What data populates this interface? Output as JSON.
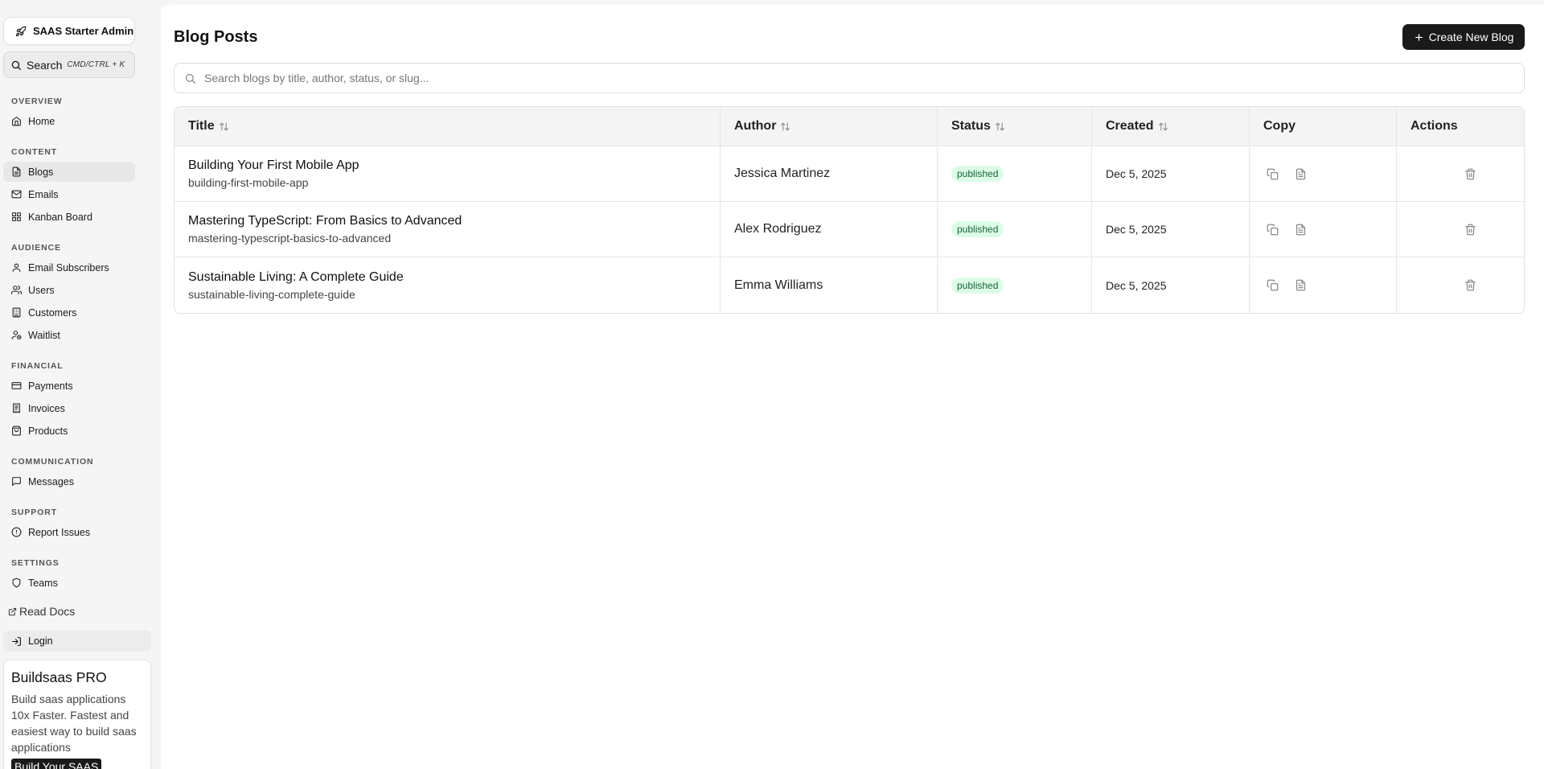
{
  "sidebar": {
    "brand": "SAAS Starter Admin",
    "search": {
      "label": "Search",
      "shortcut": "CMD/CTRL + K"
    },
    "sections": {
      "overview": "OVERVIEW",
      "content": "CONTENT",
      "audience": "AUDIENCE",
      "financial": "FINANCIAL",
      "communication": "COMMUNICATION",
      "support": "SUPPORT",
      "settings": "SETTINGS"
    },
    "items": {
      "home": "Home",
      "blogs": "Blogs",
      "emails": "Emails",
      "kanban": "Kanban Board",
      "subscribers": "Email Subscribers",
      "users": "Users",
      "customers": "Customers",
      "waitlist": "Waitlist",
      "payments": "Payments",
      "invoices": "Invoices",
      "products": "Products",
      "messages": "Messages",
      "report": "Report Issues",
      "teams": "Teams"
    },
    "read_docs": "Read Docs",
    "login": "Login",
    "promo": {
      "title": "Buildsaas PRO",
      "text": "Build saas applications 10x Faster. Fastest and easiest way to build saas applications",
      "button": "Build Your SAAS"
    }
  },
  "main": {
    "title": "Blog Posts",
    "create_button": "Create New Blog",
    "search_placeholder": "Search blogs by title, author, status, or slug...",
    "columns": {
      "title": "Title",
      "author": "Author",
      "status": "Status",
      "created": "Created",
      "copy": "Copy",
      "actions": "Actions"
    },
    "rows": [
      {
        "title": "Building Your First Mobile App",
        "slug": "building-first-mobile-app",
        "author": "Jessica Martinez",
        "status": "published",
        "created": "Dec 5, 2025"
      },
      {
        "title": "Mastering TypeScript: From Basics to Advanced",
        "slug": "mastering-typescript-basics-to-advanced",
        "author": "Alex Rodriguez",
        "status": "published",
        "created": "Dec 5, 2025"
      },
      {
        "title": "Sustainable Living: A Complete Guide",
        "slug": "sustainable-living-complete-guide",
        "author": "Emma Williams",
        "status": "published",
        "created": "Dec 5, 2025"
      }
    ]
  },
  "colors": {
    "accent": "#1a1a1a",
    "badge_bg": "#dcfce7",
    "badge_text": "#166534",
    "active_nav": "#e8e8e8"
  }
}
